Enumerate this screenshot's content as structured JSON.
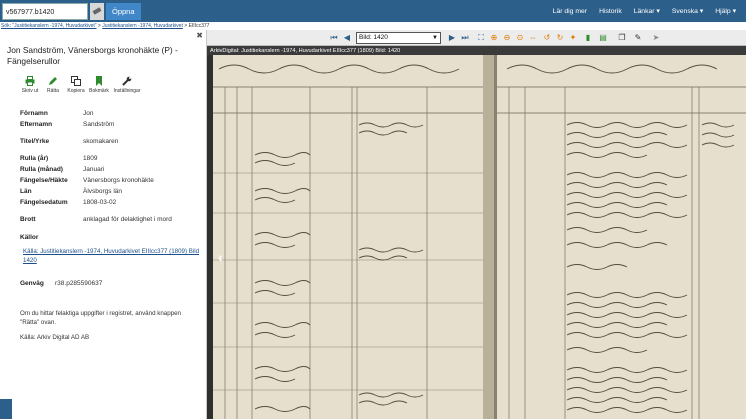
{
  "topbar": {
    "search_value": "v567977.b1420",
    "open_button": "Öppna",
    "menu": [
      "Lär dig mer",
      "Historik",
      "Länkar ▾",
      "Svenska ▾",
      "Hjälp ▾"
    ]
  },
  "breadcrumb": {
    "part1": "Sök: \"Justitiekanslern -1974, Huvudarkivet\"",
    "sep1": " > ",
    "part2": "Justitiekanslern -1974, Huvudarkivet",
    "sep2": " > ",
    "part3": "EIIIcc377"
  },
  "panel": {
    "title": "Jon Sandström, Vänersborgs kronohäkte (P) - Fängelserullor",
    "tools": [
      "Skriv ut",
      "Rätta",
      "Kopiera",
      "Bokmärk",
      "Inställningar"
    ],
    "fields": [
      {
        "label": "Förnamn",
        "value": "Jon"
      },
      {
        "label": "Efternamn",
        "value": "Sandström"
      },
      {
        "label": "Titel/Yrke",
        "value": "skomakaren"
      },
      {
        "label": "Rulla (år)",
        "value": "1809"
      },
      {
        "label": "Rulla (månad)",
        "value": "Januari"
      },
      {
        "label": "Fängelse/Häkte",
        "value": "Vänersborgs kronohäkte"
      },
      {
        "label": "Län",
        "value": "Älvsborgs län"
      },
      {
        "label": "Fängelsedatum",
        "value": "1808-03-02"
      },
      {
        "label": "Brott",
        "value": "anklagad för delaktighet i mord"
      }
    ],
    "sources_label": "Källor",
    "source_link": "Källa: Justitiekanslern -1974, Huvudarkivet EIIIcc377 (1809) Bild 1420",
    "genvag_label": "Genväg",
    "genvag_value": "r38.p285590637",
    "note": "Om du hittar felaktiga uppgifter i registret, använd knappen \"Rätta\" ovan.",
    "credit": "Källa: Arkiv Digital AD AB"
  },
  "viewer": {
    "image_select": "Bild: 1420",
    "caption": "ArkivDigital: Justitiekanslern -1974, Huvudarkivet EIIIcc377 (1809) Bild: 1420"
  },
  "colors": {
    "topbar": "#2c5f8a",
    "link": "#1a4f8b",
    "paper": "#e8e2d2"
  }
}
